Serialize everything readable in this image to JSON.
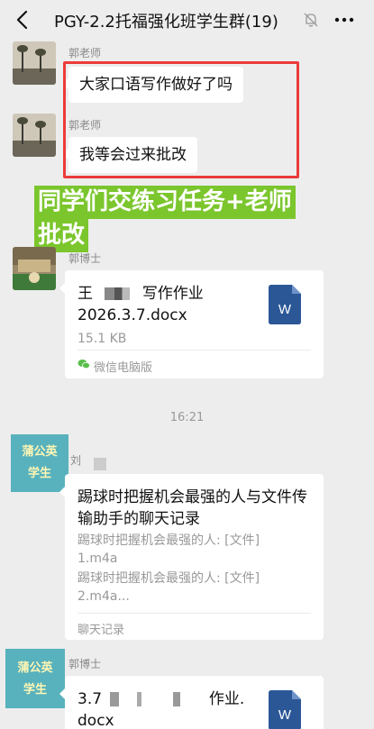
{
  "header": {
    "title": "PGY-2.2托福强化班学生群(19)",
    "back_icon": "chevron-left-icon",
    "mute_icon": "bell-off-icon",
    "more_icon": "ellipsis-icon"
  },
  "messages": [
    {
      "sender": "郭老师",
      "text": "大家口语写作做好了吗"
    },
    {
      "sender": "郭老师",
      "text": "我等会过来批改"
    }
  ],
  "banner": {
    "line1": "同学们交练习任务+老师",
    "line2": "批改"
  },
  "file1": {
    "sender": "郭博士",
    "name_line1_a": "王",
    "name_line1_b": "写作作业",
    "name_line2": "2026.3.7.docx",
    "size": "15.1 KB",
    "source": "微信电脑版",
    "icon_letter": "W"
  },
  "timestamp": "16:21",
  "chat_record": {
    "sender": "刘",
    "avatar_line1": "蒲公英",
    "avatar_line2": "学生",
    "title": "踢球时把握机会最强的人与文件传输助手的聊天记录",
    "line1": "踢球时把握机会最强的人: [文件]",
    "line2": "1.m4a",
    "line3": "踢球时把握机会最强的人: [文件]",
    "line4": "2.m4a...",
    "footer": "聊天记录"
  },
  "file2": {
    "sender": "郭博士",
    "avatar_line1": "蒲公英",
    "avatar_line2": "学生",
    "name_line1_a": "3.7",
    "name_line1_b": "作业.",
    "name_line2": "docx",
    "icon_letter": "W"
  },
  "colors": {
    "background": "#ededed",
    "highlight_box": "#ec3b3b",
    "banner_green": "#7bc62d",
    "word_blue": "#2b5797"
  }
}
